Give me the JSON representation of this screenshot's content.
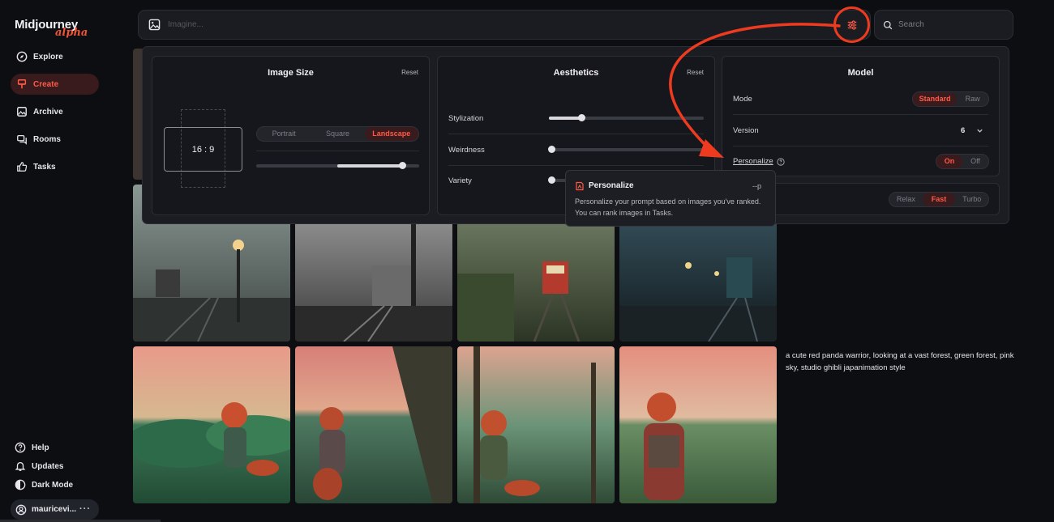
{
  "app": {
    "logo_text": "Midjourney",
    "logo_sub": "alpha"
  },
  "sidebar": {
    "items": [
      {
        "label": "Explore",
        "icon": "compass-icon",
        "active": false
      },
      {
        "label": "Create",
        "icon": "brush-icon",
        "active": true
      },
      {
        "label": "Archive",
        "icon": "image-icon",
        "active": false
      },
      {
        "label": "Rooms",
        "icon": "chat-icon",
        "active": false
      },
      {
        "label": "Tasks",
        "icon": "thumbs-up-icon",
        "active": false
      }
    ],
    "bottom": [
      {
        "label": "Help",
        "icon": "help-icon"
      },
      {
        "label": "Updates",
        "icon": "bell-icon"
      },
      {
        "label": "Dark Mode",
        "icon": "moon-icon"
      }
    ],
    "user": {
      "name": "mauricevi...",
      "more": "···"
    }
  },
  "prompt": {
    "placeholder": "Imagine...",
    "value": ""
  },
  "search": {
    "placeholder": "Search"
  },
  "settings": {
    "image_size": {
      "title": "Image Size",
      "reset": "Reset",
      "ratio": "16 : 9",
      "orientation": {
        "options": [
          "Portrait",
          "Square",
          "Landscape"
        ],
        "selected": "Landscape"
      },
      "slider_value": 0.9
    },
    "aesthetics": {
      "title": "Aesthetics",
      "reset": "Reset",
      "sliders": [
        {
          "label": "Stylization",
          "value": 0.2
        },
        {
          "label": "Weirdness",
          "value": 0.0
        },
        {
          "label": "Variety",
          "value": 0.0
        }
      ]
    },
    "model": {
      "title": "Model",
      "mode": {
        "label": "Mode",
        "options": [
          "Standard",
          "Raw"
        ],
        "selected": "Standard"
      },
      "version": {
        "label": "Version",
        "value": "6"
      },
      "personalize": {
        "label": "Personalize",
        "options": [
          "On",
          "Off"
        ],
        "selected": "On"
      }
    },
    "speed": {
      "options": [
        "Relax",
        "Fast",
        "Turbo"
      ],
      "selected": "Fast"
    }
  },
  "tooltip": {
    "title": "Personalize",
    "flag": "--p",
    "body": "Personalize your prompt based on images you've ranked. You can rank images in Tasks."
  },
  "gallery": {
    "caption": "a cute red panda warrior, looking at a vast forest, green forest, pink sky, studio ghibli japanimation style"
  },
  "colors": {
    "accent": "#ff5a46",
    "annotation": "#ee3b1f"
  }
}
